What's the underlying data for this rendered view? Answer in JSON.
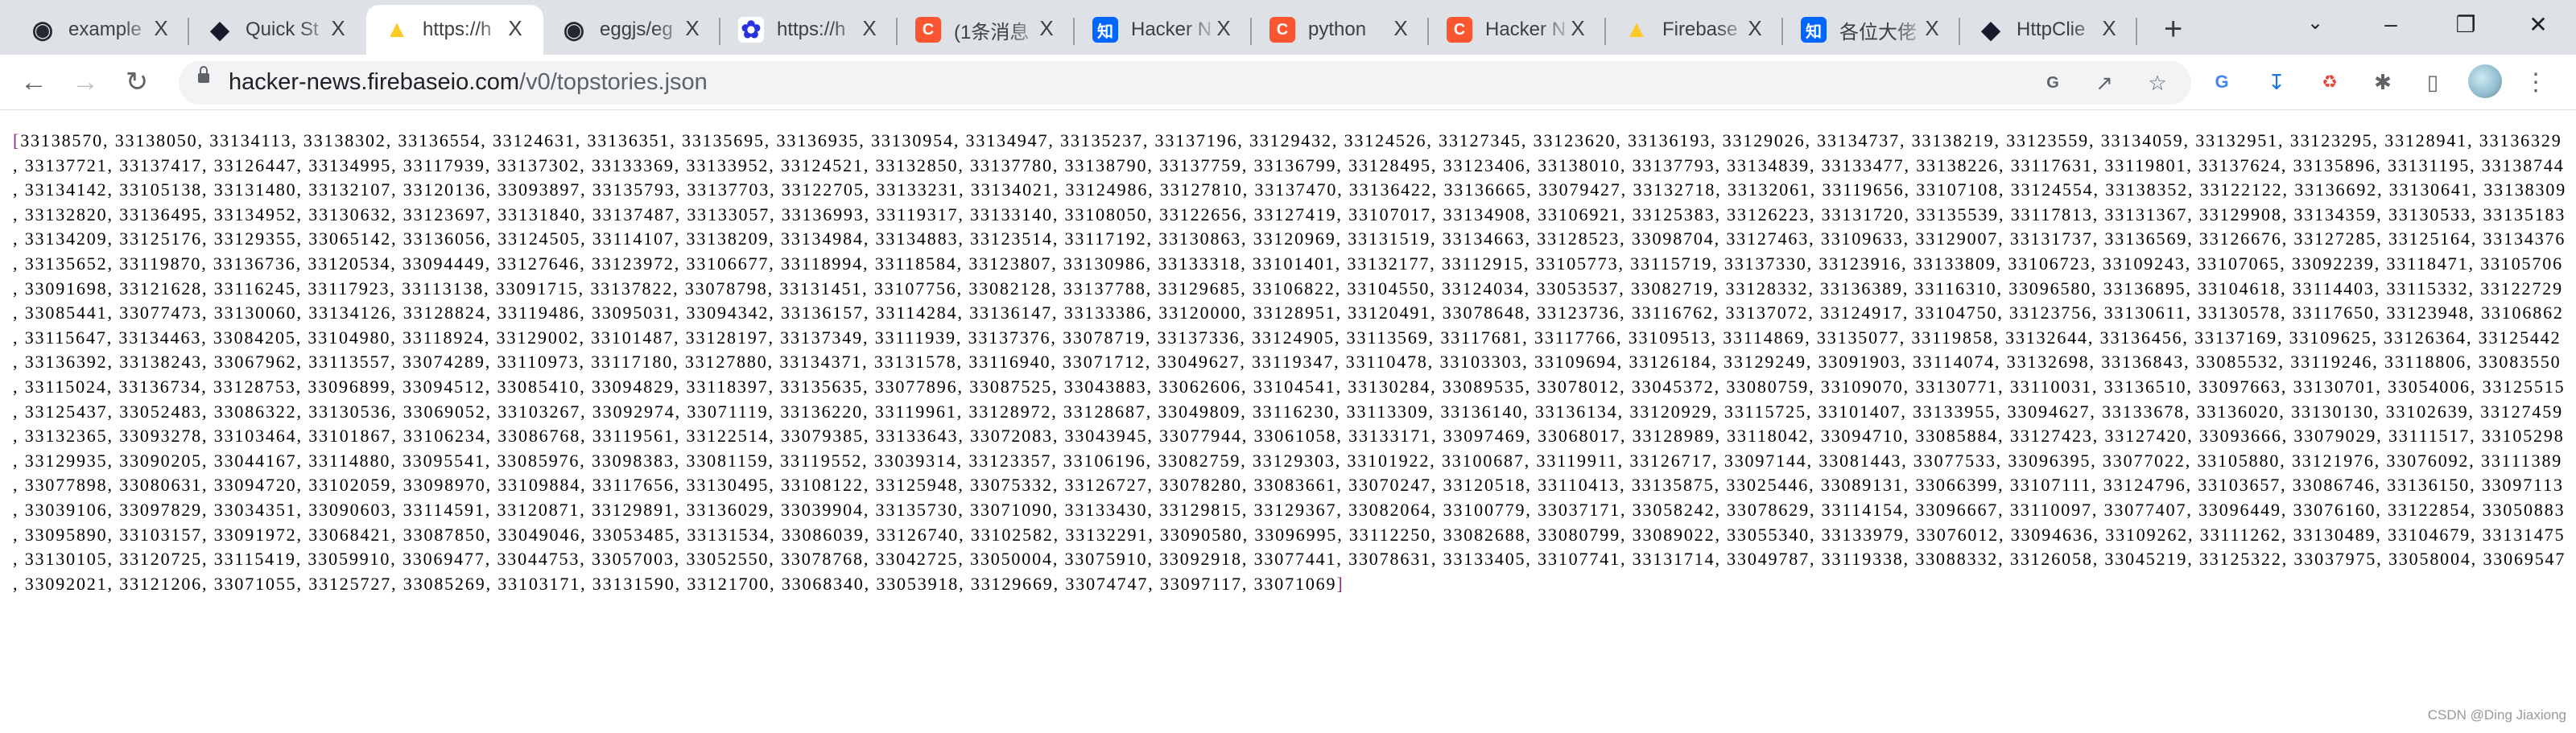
{
  "browser": {
    "tabs": [
      {
        "title": "example",
        "icon": "github-icon",
        "color": "#24292f",
        "active": false
      },
      {
        "title": "Quick St",
        "icon": "httpclient-icon",
        "color": "#1a1a2e",
        "active": false
      },
      {
        "title": "https://h",
        "icon": "firebase-icon",
        "color": "#ffca28",
        "active": true
      },
      {
        "title": "eggjs/eg",
        "icon": "github-icon",
        "color": "#24292f",
        "active": false
      },
      {
        "title": "https://h",
        "icon": "baidu-icon",
        "color": "#2932e1",
        "active": false
      },
      {
        "title": "(1条消息",
        "icon": "csdn-icon",
        "color": "#fc5531",
        "active": false
      },
      {
        "title": "Hacker N",
        "icon": "zhihu-icon",
        "color": "#0066ff",
        "active": false
      },
      {
        "title": "python",
        "icon": "csdn-icon",
        "color": "#fc5531",
        "active": false
      },
      {
        "title": "Hacker N",
        "icon": "csdn-icon",
        "color": "#fc5531",
        "active": false
      },
      {
        "title": "Firebase",
        "icon": "firebase-icon",
        "color": "#ffca28",
        "active": false
      },
      {
        "title": "各位大佬",
        "icon": "zhihu-icon",
        "color": "#0066ff",
        "active": false
      },
      {
        "title": "HttpClie",
        "icon": "httpclient-icon",
        "color": "#1a1a2e",
        "active": false
      }
    ],
    "close_glyph": "X",
    "new_tab_glyph": "+",
    "address": {
      "host": "hacker-news.firebaseio.com",
      "path": "/v0/topstories.json"
    }
  },
  "content": {
    "open_bracket": "[",
    "close_bracket": "]",
    "story_ids": [
      33138570,
      33138050,
      33134113,
      33138302,
      33136554,
      33124631,
      33136351,
      33135695,
      33136935,
      33130954,
      33134947,
      33135237,
      33137196,
      33129432,
      33124526,
      33127345,
      33123620,
      33136193,
      33129026,
      33134737,
      33138219,
      33123559,
      33134059,
      33132951,
      33123295,
      33128941,
      33136329,
      33137721,
      33137417,
      33126447,
      33134995,
      33117939,
      33137302,
      33133369,
      33133952,
      33124521,
      33132850,
      33137780,
      33138790,
      33137759,
      33136799,
      33128495,
      33123406,
      33138010,
      33137793,
      33134839,
      33133477,
      33138226,
      33117631,
      33119801,
      33137624,
      33135896,
      33131195,
      33138744,
      33134142,
      33105138,
      33131480,
      33132107,
      33120136,
      33093897,
      33135793,
      33137703,
      33122705,
      33133231,
      33134021,
      33124986,
      33127810,
      33137470,
      33136422,
      33136665,
      33079427,
      33132718,
      33132061,
      33119656,
      33107108,
      33124554,
      33138352,
      33122122,
      33136692,
      33130641,
      33138309,
      33132820,
      33136495,
      33134952,
      33130632,
      33123697,
      33131840,
      33137487,
      33133057,
      33136993,
      33119317,
      33133140,
      33108050,
      33122656,
      33127419,
      33107017,
      33134908,
      33106921,
      33125383,
      33126223,
      33131720,
      33135539,
      33117813,
      33131367,
      33129908,
      33134359,
      33130533,
      33135183,
      33134209,
      33125176,
      33129355,
      33065142,
      33136056,
      33124505,
      33114107,
      33138209,
      33134984,
      33134883,
      33123514,
      33117192,
      33130863,
      33120969,
      33131519,
      33134663,
      33128523,
      33098704,
      33127463,
      33109633,
      33129007,
      33131737,
      33136569,
      33126676,
      33127285,
      33125164,
      33134376,
      33135652,
      33119870,
      33136736,
      33120534,
      33094449,
      33127646,
      33123972,
      33106677,
      33118994,
      33118584,
      33123807,
      33130986,
      33133318,
      33101401,
      33132177,
      33112915,
      33105773,
      33115719,
      33137330,
      33123916,
      33133809,
      33106723,
      33109243,
      33107065,
      33092239,
      33118471,
      33105706,
      33091698,
      33121628,
      33116245,
      33117923,
      33113138,
      33091715,
      33137822,
      33078798,
      33131451,
      33107756,
      33082128,
      33137788,
      33129685,
      33106822,
      33104550,
      33124034,
      33053537,
      33082719,
      33128332,
      33136389,
      33116310,
      33096580,
      33136895,
      33104618,
      33114403,
      33115332,
      33122729,
      33085441,
      33077473,
      33130060,
      33134126,
      33128824,
      33119486,
      33095031,
      33094342,
      33136157,
      33114284,
      33136147,
      33133386,
      33120000,
      33128951,
      33120491,
      33078648,
      33123736,
      33116762,
      33137072,
      33124917,
      33104750,
      33123756,
      33130611,
      33130578,
      33117650,
      33123948,
      33106862,
      33115647,
      33134463,
      33084205,
      33104980,
      33118924,
      33129002,
      33101487,
      33128197,
      33137349,
      33111939,
      33137376,
      33078719,
      33137336,
      33124905,
      33113569,
      33117681,
      33117766,
      33109513,
      33114869,
      33135077,
      33119858,
      33132644,
      33136456,
      33137169,
      33109625,
      33126364,
      33125442,
      33136392,
      33138243,
      33067962,
      33113557,
      33074289,
      33110973,
      33117180,
      33127880,
      33134371,
      33131578,
      33116940,
      33071712,
      33049627,
      33119347,
      33110478,
      33103303,
      33109694,
      33126184,
      33129249,
      33091903,
      33114074,
      33132698,
      33136843,
      33085532,
      33119246,
      33118806,
      33083550,
      33115024,
      33136734,
      33128753,
      33096899,
      33094512,
      33085410,
      33094829,
      33118397,
      33135635,
      33077896,
      33087525,
      33043883,
      33062606,
      33104541,
      33130284,
      33089535,
      33078012,
      33045372,
      33080759,
      33109070,
      33130771,
      33110031,
      33136510,
      33097663,
      33130701,
      33054006,
      33125515,
      33125437,
      33052483,
      33086322,
      33130536,
      33069052,
      33103267,
      33092974,
      33071119,
      33136220,
      33119961,
      33128972,
      33128687,
      33049809,
      33116230,
      33113309,
      33136140,
      33136134,
      33120929,
      33115725,
      33101407,
      33133955,
      33094627,
      33133678,
      33136020,
      33130130,
      33102639,
      33127459,
      33132365,
      33093278,
      33103464,
      33101867,
      33106234,
      33086768,
      33119561,
      33122514,
      33079385,
      33133643,
      33072083,
      33043945,
      33077944,
      33061058,
      33133171,
      33097469,
      33068017,
      33128989,
      33118042,
      33094710,
      33085884,
      33127423,
      33127420,
      33093666,
      33079029,
      33111517,
      33105298,
      33129935,
      33090205,
      33044167,
      33114880,
      33095541,
      33085976,
      33098383,
      33081159,
      33119552,
      33039314,
      33123357,
      33106196,
      33082759,
      33129303,
      33101922,
      33100687,
      33119911,
      33126717,
      33097144,
      33081443,
      33077533,
      33096395,
      33077022,
      33105880,
      33121976,
      33076092,
      33111389,
      33077898,
      33080631,
      33094720,
      33102059,
      33098970,
      33109884,
      33117656,
      33130495,
      33108122,
      33125948,
      33075332,
      33126727,
      33078280,
      33083661,
      33070247,
      33120518,
      33110413,
      33135875,
      33025446,
      33089131,
      33066399,
      33107111,
      33124796,
      33103657,
      33086746,
      33136150,
      33097113,
      33039106,
      33097829,
      33034351,
      33090603,
      33114591,
      33120871,
      33129891,
      33136029,
      33039904,
      33135730,
      33071090,
      33133430,
      33129815,
      33129367,
      33082064,
      33100779,
      33037171,
      33058242,
      33078629,
      33114154,
      33096667,
      33110097,
      33077407,
      33096449,
      33076160,
      33122854,
      33050883,
      33095890,
      33103157,
      33091972,
      33068421,
      33087850,
      33049046,
      33053485,
      33131534,
      33086039,
      33126740,
      33102582,
      33132291,
      33090580,
      33096995,
      33112250,
      33082688,
      33080799,
      33089022,
      33055340,
      33133979,
      33076012,
      33094636,
      33109262,
      33111262,
      33130489,
      33104679,
      33131475,
      33130105,
      33120725,
      33115419,
      33059910,
      33069477,
      33044753,
      33057003,
      33052550,
      33078768,
      33042725,
      33050004,
      33075910,
      33092918,
      33077441,
      33078631,
      33133405,
      33107741,
      33131714,
      33049787,
      33119338,
      33088332,
      33126058,
      33045219,
      33125322,
      33037975,
      33058004,
      33069547,
      33092021,
      33121206,
      33071055,
      33125727,
      33085269,
      33103171,
      33131590,
      33121700,
      33068340,
      33053918,
      33129669,
      33074747,
      33097117,
      33071069
    ]
  },
  "watermark": "CSDN @Ding Jiaxiong"
}
